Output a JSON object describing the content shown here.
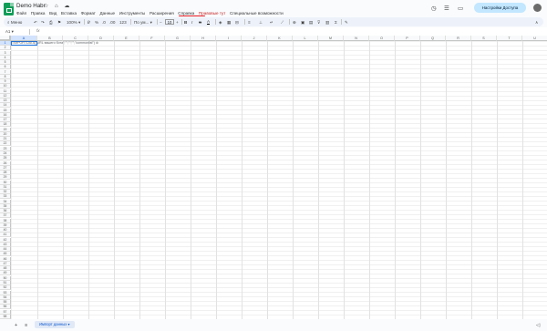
{
  "app": {
    "title": "Demo Habr",
    "title_icons": "☆ ⌂ ☁"
  },
  "menu": [
    "Файл",
    "Правка",
    "Вид",
    "Вставка",
    "Формат",
    "Данные",
    "Инструменты",
    "Расширения",
    "Справка",
    "Правовые тут",
    "Специальные возможности"
  ],
  "menu_active_index": 9,
  "header_right": {
    "history_icon": "◷",
    "comment_icon": "☰",
    "meet_icon": "▭",
    "share_label": "Настройки Доступа"
  },
  "toolbar": {
    "search_label": "Меню",
    "undo": "↶",
    "redo": "↷",
    "print": "⎙",
    "paint": "⚑",
    "zoom": "100%",
    "currency": "₽",
    "percent": "%",
    "dec_minus": ".0",
    "dec_plus": ".00",
    "more_formats": "123",
    "font_family": "По ум...",
    "font_minus": "−",
    "font_size": "10",
    "font_plus": "+",
    "bold": "B",
    "italic": "I",
    "strike": "S",
    "text_color": "A",
    "fill": "◈",
    "borders": "▦",
    "merge": "⊟",
    "align": "≡",
    "valign": "⊥",
    "wrap": "↵",
    "rotate": "⟋",
    "link": "⊕",
    "comment": "▣",
    "chart": "▤",
    "filter": "⊽",
    "views": "▥",
    "functions": "Σ",
    "input": "✎",
    "collapse": "∧"
  },
  "formula_bar": {
    "name_box": "A1",
    "fx": "fx"
  },
  "grid": {
    "columns": [
      "A",
      "B",
      "C",
      "D",
      "E",
      "F",
      "G",
      "H",
      "I",
      "J",
      "K",
      "L",
      "M",
      "N",
      "O",
      "P",
      "Q",
      "R",
      "S",
      "T",
      "U",
      "V"
    ],
    "rows": 58,
    "selected_cell": "A1",
    "a1_text_prefix": "=IMPORTDATA(",
    "a1_text_rest": "\"URL вашего бота\";\"\";\"\";\"\";\"commonlist\")",
    "a1_hint_icon": "⊛"
  },
  "sheet_tabs": {
    "add_icon": "+",
    "list_icon": "≡",
    "tab_label": "Импорт данных",
    "tab_arrow": "▾",
    "right_icon": "◁"
  },
  "colors": {
    "accent": "#1a73e8",
    "active_menu": "#e31b23",
    "share_button": "#c2e7ff",
    "logo": "#0f9d58"
  }
}
